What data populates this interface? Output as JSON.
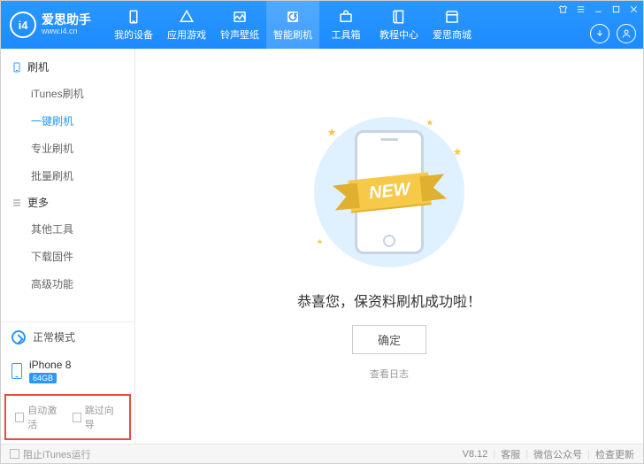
{
  "header": {
    "logo_name": "爱思助手",
    "logo_url": "www.i4.cn",
    "tabs": [
      {
        "label": "我的设备"
      },
      {
        "label": "应用游戏"
      },
      {
        "label": "铃声壁纸"
      },
      {
        "label": "智能刷机"
      },
      {
        "label": "工具箱"
      },
      {
        "label": "教程中心"
      },
      {
        "label": "爱思商城"
      }
    ],
    "active_tab": 3
  },
  "sidebar": {
    "group1": {
      "title": "刷机",
      "items": [
        {
          "label": "iTunes刷机"
        },
        {
          "label": "一键刷机"
        },
        {
          "label": "专业刷机"
        },
        {
          "label": "批量刷机"
        }
      ],
      "active": 1
    },
    "group2": {
      "title": "更多",
      "items": [
        {
          "label": "其他工具"
        },
        {
          "label": "下载固件"
        },
        {
          "label": "高级功能"
        }
      ]
    },
    "mode_label": "正常模式",
    "device_name": "iPhone 8",
    "device_badge": "64GB",
    "auto_activate": "自动激活",
    "skip_wizard": "跳过向导"
  },
  "main": {
    "ribbon": "NEW",
    "message": "恭喜您，保资料刷机成功啦！",
    "ok": "确定",
    "view_log": "查看日志"
  },
  "statusbar": {
    "block_itunes": "阻止iTunes运行",
    "version": "V8.12",
    "support": "客服",
    "wechat": "微信公众号",
    "update": "检查更新"
  }
}
